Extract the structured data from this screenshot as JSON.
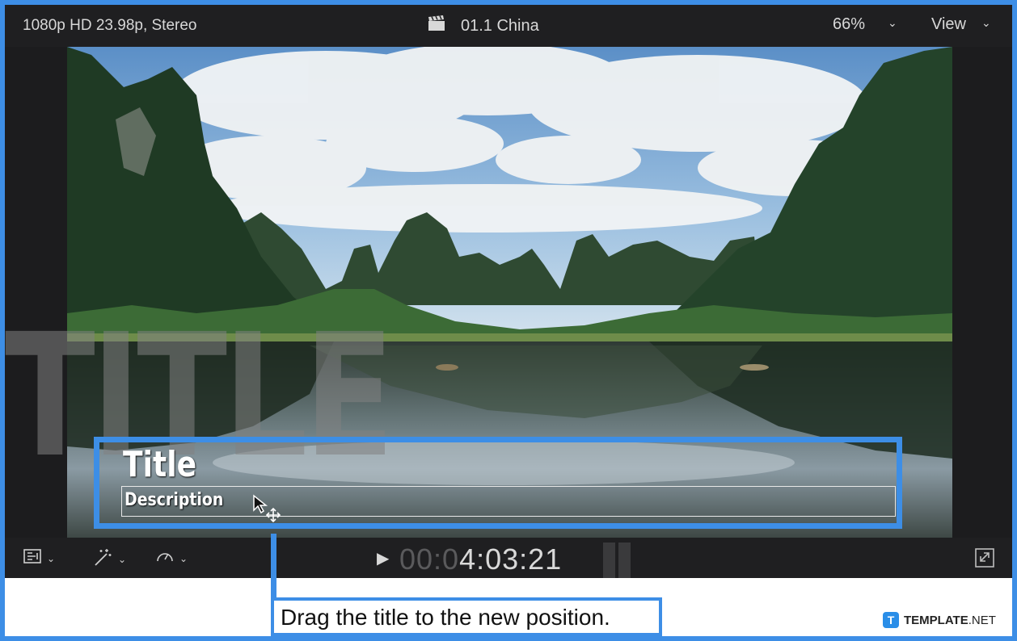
{
  "topbar": {
    "format": "1080p HD 23.98p, Stereo",
    "clip_name": "01.1 China",
    "zoom": "66%",
    "view_label": "View"
  },
  "overlay": {
    "ghost_text": "TITLE",
    "title": "Title",
    "description": "Description"
  },
  "playback": {
    "timecode_dim": "00:0",
    "timecode_lit": "4:03:21"
  },
  "caption": {
    "text": "Drag the title to the new position."
  },
  "brand": {
    "logo_letter": "T",
    "name_bold": "TEMPLATE",
    "name_rest": ".NET"
  },
  "colors": {
    "accent": "#3d8ee6",
    "viewer_bg": "#1c1c1e"
  }
}
